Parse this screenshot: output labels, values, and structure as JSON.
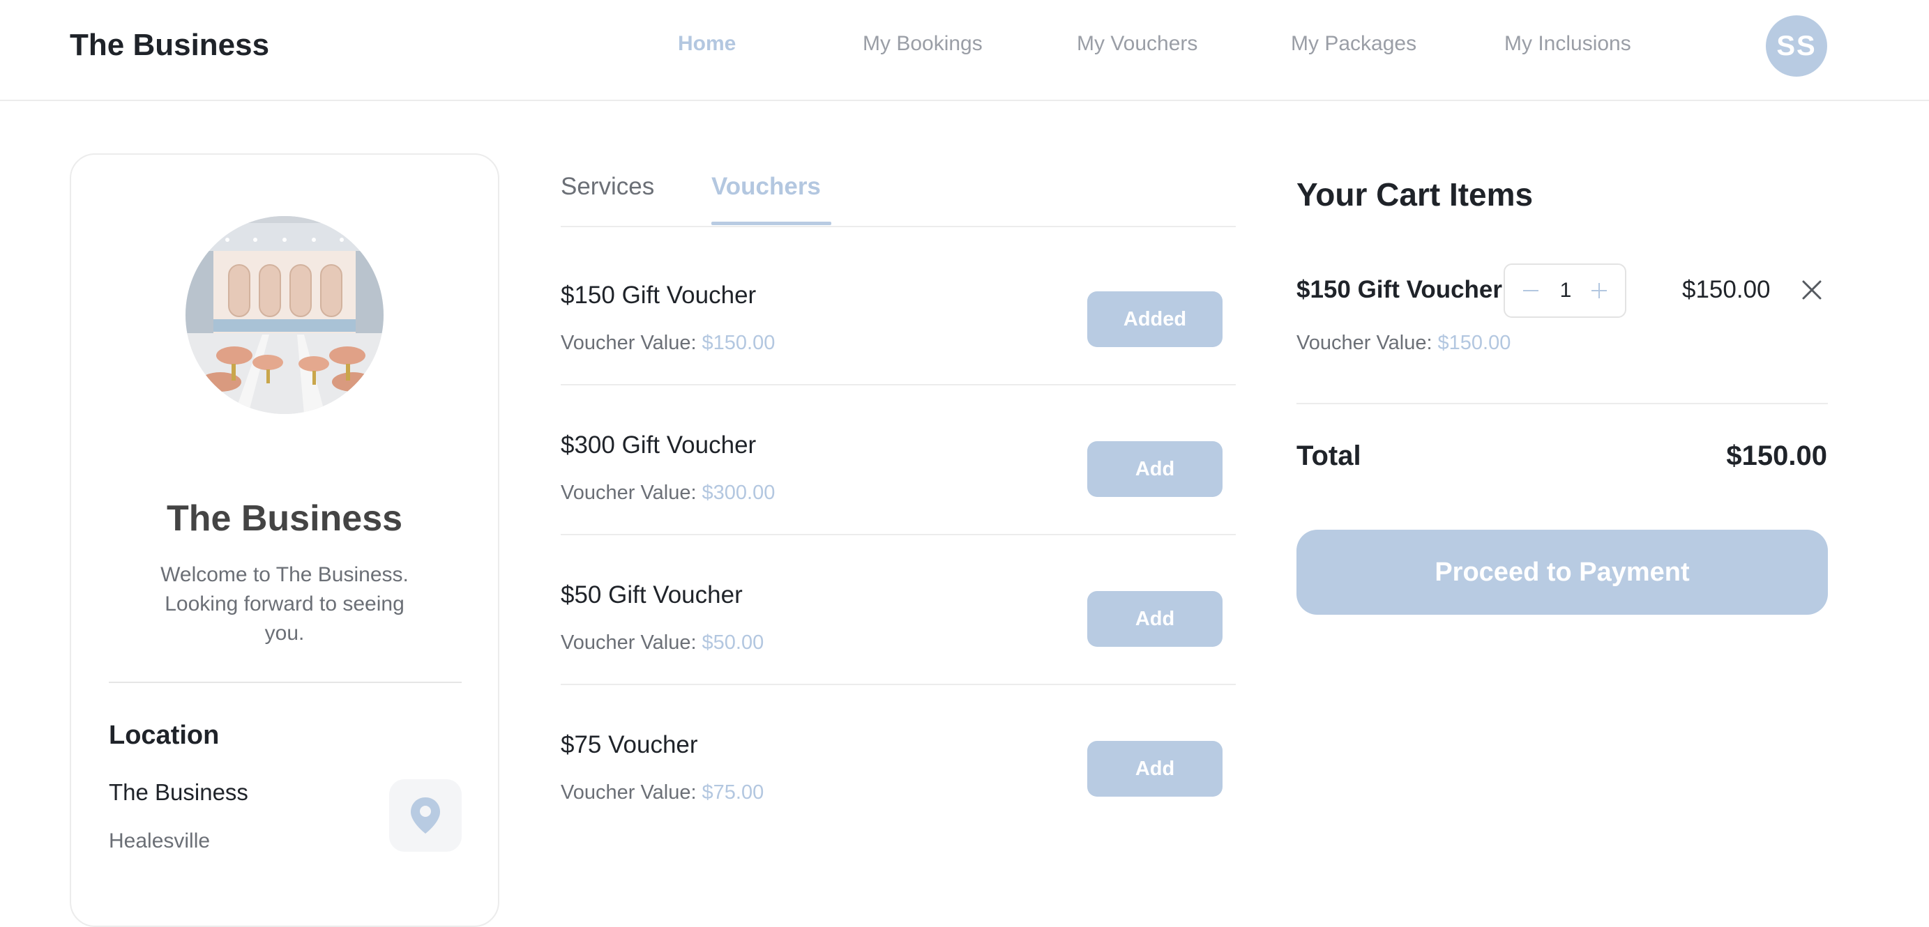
{
  "header": {
    "brand": "The Business",
    "nav": [
      {
        "label": "Home",
        "active": true
      },
      {
        "label": "My Bookings",
        "active": false
      },
      {
        "label": "My Vouchers",
        "active": false
      },
      {
        "label": "My Packages",
        "active": false
      },
      {
        "label": "My Inclusions",
        "active": false
      }
    ],
    "avatar_initials": "SS"
  },
  "business": {
    "name": "The Business",
    "welcome": "Welcome to The Business. Looking forward to seeing you.",
    "location_heading": "Location",
    "location_name": "The Business",
    "location_city": "Healesville"
  },
  "tabs": [
    {
      "label": "Services",
      "active": false
    },
    {
      "label": "Vouchers",
      "active": true
    }
  ],
  "vouchers": [
    {
      "name": "$150 Gift Voucher",
      "value_label": "Voucher Value:",
      "value": "$150.00",
      "button": "Added"
    },
    {
      "name": "$300 Gift Voucher",
      "value_label": "Voucher Value:",
      "value": "$300.00",
      "button": "Add"
    },
    {
      "name": "$50 Gift Voucher",
      "value_label": "Voucher Value:",
      "value": "$50.00",
      "button": "Add"
    },
    {
      "name": "$75 Voucher",
      "value_label": "Voucher Value:",
      "value": "$75.00",
      "button": "Add"
    }
  ],
  "cart": {
    "title": "Your Cart Items",
    "items": [
      {
        "name": "$150 Gift Voucher",
        "quantity": "1",
        "price": "$150.00",
        "value_label": "Voucher Value:",
        "value": "$150.00"
      }
    ],
    "total_label": "Total",
    "total_value": "$150.00",
    "proceed_label": "Proceed to Payment"
  },
  "colors": {
    "accent": "#b8cbe2",
    "accent_text": "#b3c7e0",
    "muted_text": "#6b6f76",
    "dark_text": "#1f2329"
  },
  "icons": [
    "user-avatar",
    "map-pin-icon",
    "minus-icon",
    "plus-icon",
    "close-icon"
  ]
}
